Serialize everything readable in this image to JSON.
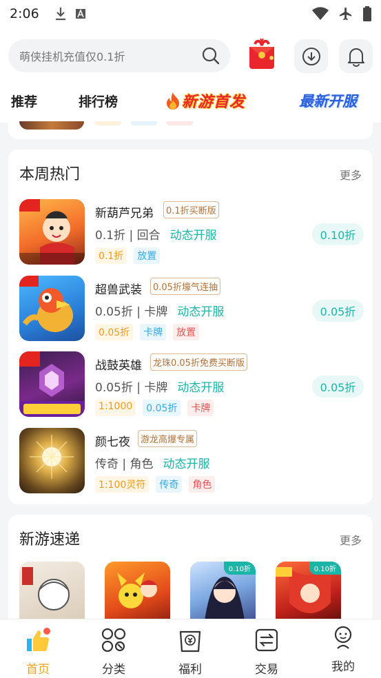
{
  "status_bar": {
    "time": "2:06",
    "icons": [
      "download-icon",
      "font-a-icon",
      "wifi-icon",
      "airplane-icon",
      "battery-icon"
    ]
  },
  "search": {
    "placeholder": "萌侠挂机充值仅0.1折"
  },
  "header": {
    "icons": [
      "search-icon",
      "red-envelope-gift-icon",
      "download-circle-icon",
      "bell-icon"
    ]
  },
  "tabs": [
    {
      "label": "推荐"
    },
    {
      "label": "排行榜"
    },
    {
      "label": "新游首发"
    },
    {
      "label": "最新开服"
    }
  ],
  "hot_section": {
    "title": "本周热门",
    "more": "更多",
    "games": [
      {
        "name": "新葫芦兄弟",
        "promo": "0.1折买断版",
        "meta": "0.1折 | 回合",
        "dynamic": "动态开服",
        "tags": [
          {
            "text": "0.1折",
            "color": "orange"
          },
          {
            "text": "放置",
            "color": "blue"
          }
        ],
        "discount": "0.10折",
        "icon_label": "0.1折"
      },
      {
        "name": "超兽武装",
        "promo": "0.05折壕气连抽",
        "meta": "0.05折 | 卡牌",
        "dynamic": "动态开服",
        "tags": [
          {
            "text": "0.05折",
            "color": "orange"
          },
          {
            "text": "卡牌",
            "color": "blue"
          },
          {
            "text": "放置",
            "color": "red"
          }
        ],
        "discount": "0.05折",
        "icon_label": "0.05折"
      },
      {
        "name": "战鼓英雄",
        "promo": "龙珠0.05折免费买断版",
        "meta": "0.05折 | 卡牌",
        "dynamic": "动态开服",
        "tags": [
          {
            "text": "1:1000",
            "color": "orange"
          },
          {
            "text": "0.05折",
            "color": "blue"
          },
          {
            "text": "卡牌",
            "color": "red"
          }
        ],
        "discount": "0.05折",
        "icon_label": "买断",
        "icon_sub": "畅享超值奖励"
      },
      {
        "name": "颜七夜",
        "promo": "游龙高爆专属",
        "meta": "传奇 | 角色",
        "dynamic": "动态开服",
        "tags": [
          {
            "text": "1:100灵符",
            "color": "orange"
          },
          {
            "text": "传奇",
            "color": "blue"
          },
          {
            "text": "角色",
            "color": "red"
          }
        ]
      }
    ]
  },
  "new_section": {
    "title": "新游速递",
    "more": "更多",
    "games": [
      {
        "badge": ""
      },
      {
        "badge": ""
      },
      {
        "badge": "0.10折"
      },
      {
        "badge": "0.10折"
      }
    ]
  },
  "bottom_nav": [
    {
      "label": "首页",
      "icon": "thumbs-up-icon",
      "active": true
    },
    {
      "label": "分类",
      "icon": "category-grid-icon",
      "active": false
    },
    {
      "label": "福利",
      "icon": "welfare-bag-icon",
      "active": false
    },
    {
      "label": "交易",
      "icon": "trade-icon",
      "active": false
    },
    {
      "label": "我的",
      "icon": "profile-icon",
      "active": false
    }
  ],
  "colors": {
    "accent_teal": "#1bb5a8",
    "active_orange": "#f2a31c",
    "tab_red": "#e8262b",
    "tab_blue": "#2a5fe0"
  }
}
